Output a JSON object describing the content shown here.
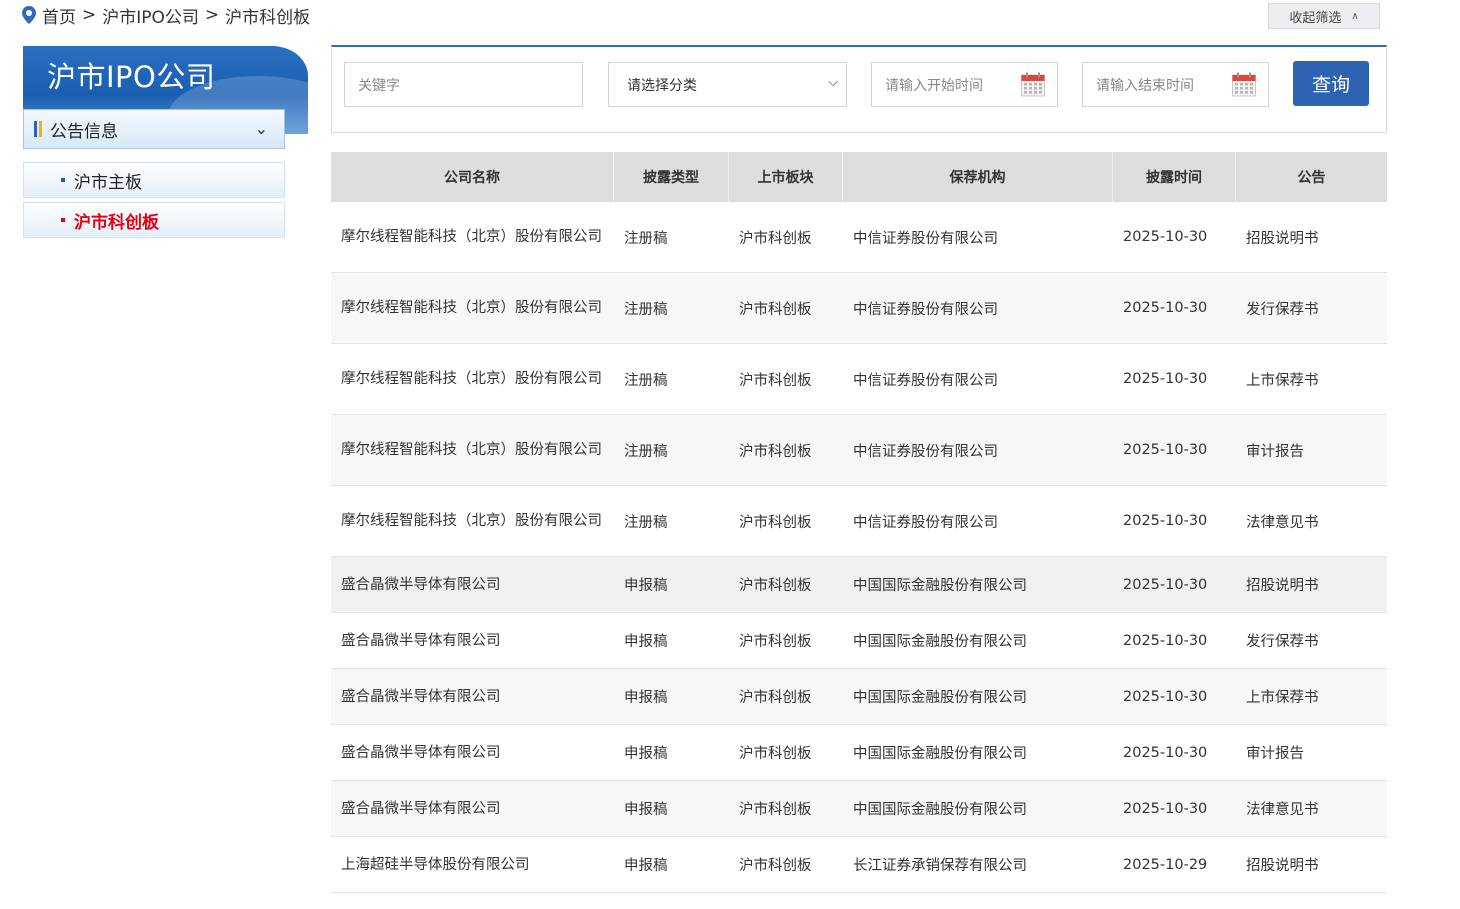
{
  "breadcrumb": {
    "items": [
      "首页",
      "沪市IPO公司",
      "沪市科创板"
    ],
    "separator": ">"
  },
  "collapse_button": {
    "label": "收起筛选"
  },
  "sidebar": {
    "title": "沪市IPO公司",
    "section": "公告信息",
    "items": [
      {
        "label": "沪市主板",
        "active": false
      },
      {
        "label": "沪市科创板",
        "active": true
      }
    ]
  },
  "filters": {
    "keyword_placeholder": "关键字",
    "category_placeholder": "请选择分类",
    "start_placeholder": "请输入开始时间",
    "end_placeholder": "请输入结束时间",
    "search_label": "查询"
  },
  "table": {
    "headers": [
      "公司名称",
      "披露类型",
      "上市板块",
      "保荐机构",
      "披露时间",
      "公告"
    ],
    "rows": [
      {
        "company": "摩尔线程智能科技（北京）股份有限公司",
        "type": "注册稿",
        "board": "沪市科创板",
        "sponsor": "中信证券股份有限公司",
        "date": "2025-10-30",
        "notice": "招股说明书"
      },
      {
        "company": "摩尔线程智能科技（北京）股份有限公司",
        "type": "注册稿",
        "board": "沪市科创板",
        "sponsor": "中信证券股份有限公司",
        "date": "2025-10-30",
        "notice": "发行保荐书"
      },
      {
        "company": "摩尔线程智能科技（北京）股份有限公司",
        "type": "注册稿",
        "board": "沪市科创板",
        "sponsor": "中信证券股份有限公司",
        "date": "2025-10-30",
        "notice": "上市保荐书"
      },
      {
        "company": "摩尔线程智能科技（北京）股份有限公司",
        "type": "注册稿",
        "board": "沪市科创板",
        "sponsor": "中信证券股份有限公司",
        "date": "2025-10-30",
        "notice": "审计报告"
      },
      {
        "company": "摩尔线程智能科技（北京）股份有限公司",
        "type": "注册稿",
        "board": "沪市科创板",
        "sponsor": "中信证券股份有限公司",
        "date": "2025-10-30",
        "notice": "法律意见书"
      },
      {
        "company": "盛合晶微半导体有限公司",
        "type": "申报稿",
        "board": "沪市科创板",
        "sponsor": "中国国际金融股份有限公司",
        "date": "2025-10-30",
        "notice": "招股说明书"
      },
      {
        "company": "盛合晶微半导体有限公司",
        "type": "申报稿",
        "board": "沪市科创板",
        "sponsor": "中国国际金融股份有限公司",
        "date": "2025-10-30",
        "notice": "发行保荐书"
      },
      {
        "company": "盛合晶微半导体有限公司",
        "type": "申报稿",
        "board": "沪市科创板",
        "sponsor": "中国国际金融股份有限公司",
        "date": "2025-10-30",
        "notice": "上市保荐书"
      },
      {
        "company": "盛合晶微半导体有限公司",
        "type": "申报稿",
        "board": "沪市科创板",
        "sponsor": "中国国际金融股份有限公司",
        "date": "2025-10-30",
        "notice": "审计报告"
      },
      {
        "company": "盛合晶微半导体有限公司",
        "type": "申报稿",
        "board": "沪市科创板",
        "sponsor": "中国国际金融股份有限公司",
        "date": "2025-10-30",
        "notice": "法律意见书"
      },
      {
        "company": "上海超硅半导体股份有限公司",
        "type": "申报稿",
        "board": "沪市科创板",
        "sponsor": "长江证券承销保荐有限公司",
        "date": "2025-10-29",
        "notice": "招股说明书"
      }
    ]
  },
  "colors": {
    "brand_blue": "#2d63b0",
    "active_red": "#e60012"
  }
}
